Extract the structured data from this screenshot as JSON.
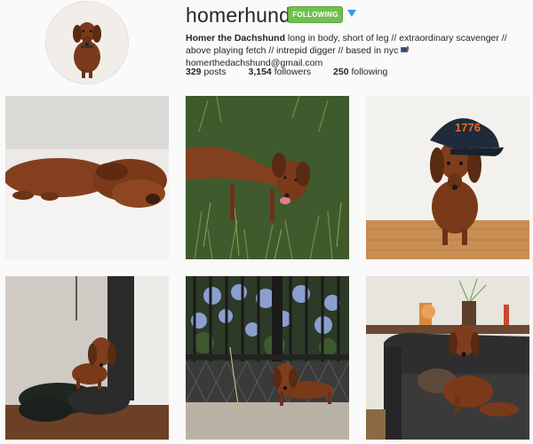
{
  "profile": {
    "username": "homerhund",
    "follow_button": "FOLLOWING",
    "bio_name": "Homer the Dachshund",
    "bio_text": " long in body, short of leg // extraordinary scavenger // above playing fetch // intrepid digger // based in nyc ",
    "bio_email": "homerthedachshund@gmail.com",
    "stats": [
      {
        "value": "329",
        "label": "posts"
      },
      {
        "value": "3,154",
        "label": "followers"
      },
      {
        "value": "250",
        "label": "following"
      }
    ]
  },
  "photos": [
    {
      "subject": "dachshund lying on white bed"
    },
    {
      "subject": "dachshund lying in grass"
    },
    {
      "subject": "dachshund wearing 1776 cap"
    },
    {
      "subject": "dachshund sitting on bags by doorway"
    },
    {
      "subject": "dachshund in front of iron fence with hydrangeas"
    },
    {
      "subject": "dachshund on leather sofa"
    }
  ],
  "colors": {
    "follow_green": "#70c050",
    "accent_blue": "#3897f0",
    "dog_brown": "#8b4020"
  }
}
